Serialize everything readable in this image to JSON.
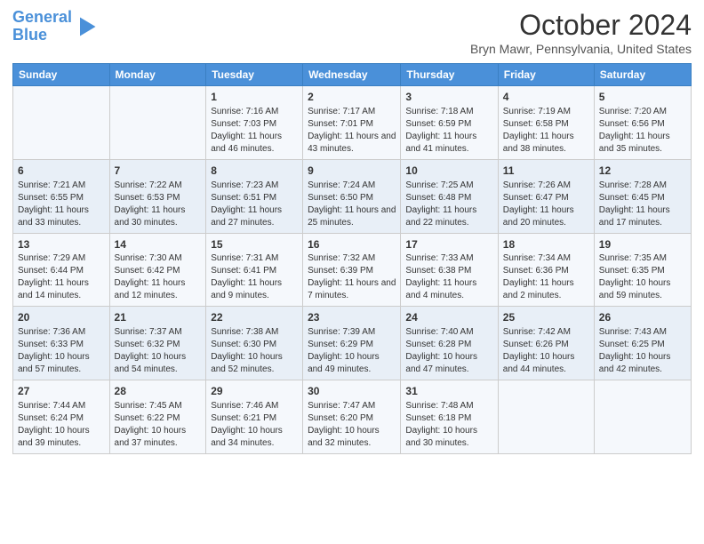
{
  "logo": {
    "text_general": "General",
    "text_blue": "Blue"
  },
  "header": {
    "month_year": "October 2024",
    "location": "Bryn Mawr, Pennsylvania, United States"
  },
  "days_of_week": [
    "Sunday",
    "Monday",
    "Tuesday",
    "Wednesday",
    "Thursday",
    "Friday",
    "Saturday"
  ],
  "weeks": [
    [
      {
        "day": "",
        "sunrise": "",
        "sunset": "",
        "daylight": ""
      },
      {
        "day": "",
        "sunrise": "",
        "sunset": "",
        "daylight": ""
      },
      {
        "day": "1",
        "sunrise": "Sunrise: 7:16 AM",
        "sunset": "Sunset: 7:03 PM",
        "daylight": "Daylight: 11 hours and 46 minutes."
      },
      {
        "day": "2",
        "sunrise": "Sunrise: 7:17 AM",
        "sunset": "Sunset: 7:01 PM",
        "daylight": "Daylight: 11 hours and 43 minutes."
      },
      {
        "day": "3",
        "sunrise": "Sunrise: 7:18 AM",
        "sunset": "Sunset: 6:59 PM",
        "daylight": "Daylight: 11 hours and 41 minutes."
      },
      {
        "day": "4",
        "sunrise": "Sunrise: 7:19 AM",
        "sunset": "Sunset: 6:58 PM",
        "daylight": "Daylight: 11 hours and 38 minutes."
      },
      {
        "day": "5",
        "sunrise": "Sunrise: 7:20 AM",
        "sunset": "Sunset: 6:56 PM",
        "daylight": "Daylight: 11 hours and 35 minutes."
      }
    ],
    [
      {
        "day": "6",
        "sunrise": "Sunrise: 7:21 AM",
        "sunset": "Sunset: 6:55 PM",
        "daylight": "Daylight: 11 hours and 33 minutes."
      },
      {
        "day": "7",
        "sunrise": "Sunrise: 7:22 AM",
        "sunset": "Sunset: 6:53 PM",
        "daylight": "Daylight: 11 hours and 30 minutes."
      },
      {
        "day": "8",
        "sunrise": "Sunrise: 7:23 AM",
        "sunset": "Sunset: 6:51 PM",
        "daylight": "Daylight: 11 hours and 27 minutes."
      },
      {
        "day": "9",
        "sunrise": "Sunrise: 7:24 AM",
        "sunset": "Sunset: 6:50 PM",
        "daylight": "Daylight: 11 hours and 25 minutes."
      },
      {
        "day": "10",
        "sunrise": "Sunrise: 7:25 AM",
        "sunset": "Sunset: 6:48 PM",
        "daylight": "Daylight: 11 hours and 22 minutes."
      },
      {
        "day": "11",
        "sunrise": "Sunrise: 7:26 AM",
        "sunset": "Sunset: 6:47 PM",
        "daylight": "Daylight: 11 hours and 20 minutes."
      },
      {
        "day": "12",
        "sunrise": "Sunrise: 7:28 AM",
        "sunset": "Sunset: 6:45 PM",
        "daylight": "Daylight: 11 hours and 17 minutes."
      }
    ],
    [
      {
        "day": "13",
        "sunrise": "Sunrise: 7:29 AM",
        "sunset": "Sunset: 6:44 PM",
        "daylight": "Daylight: 11 hours and 14 minutes."
      },
      {
        "day": "14",
        "sunrise": "Sunrise: 7:30 AM",
        "sunset": "Sunset: 6:42 PM",
        "daylight": "Daylight: 11 hours and 12 minutes."
      },
      {
        "day": "15",
        "sunrise": "Sunrise: 7:31 AM",
        "sunset": "Sunset: 6:41 PM",
        "daylight": "Daylight: 11 hours and 9 minutes."
      },
      {
        "day": "16",
        "sunrise": "Sunrise: 7:32 AM",
        "sunset": "Sunset: 6:39 PM",
        "daylight": "Daylight: 11 hours and 7 minutes."
      },
      {
        "day": "17",
        "sunrise": "Sunrise: 7:33 AM",
        "sunset": "Sunset: 6:38 PM",
        "daylight": "Daylight: 11 hours and 4 minutes."
      },
      {
        "day": "18",
        "sunrise": "Sunrise: 7:34 AM",
        "sunset": "Sunset: 6:36 PM",
        "daylight": "Daylight: 11 hours and 2 minutes."
      },
      {
        "day": "19",
        "sunrise": "Sunrise: 7:35 AM",
        "sunset": "Sunset: 6:35 PM",
        "daylight": "Daylight: 10 hours and 59 minutes."
      }
    ],
    [
      {
        "day": "20",
        "sunrise": "Sunrise: 7:36 AM",
        "sunset": "Sunset: 6:33 PM",
        "daylight": "Daylight: 10 hours and 57 minutes."
      },
      {
        "day": "21",
        "sunrise": "Sunrise: 7:37 AM",
        "sunset": "Sunset: 6:32 PM",
        "daylight": "Daylight: 10 hours and 54 minutes."
      },
      {
        "day": "22",
        "sunrise": "Sunrise: 7:38 AM",
        "sunset": "Sunset: 6:30 PM",
        "daylight": "Daylight: 10 hours and 52 minutes."
      },
      {
        "day": "23",
        "sunrise": "Sunrise: 7:39 AM",
        "sunset": "Sunset: 6:29 PM",
        "daylight": "Daylight: 10 hours and 49 minutes."
      },
      {
        "day": "24",
        "sunrise": "Sunrise: 7:40 AM",
        "sunset": "Sunset: 6:28 PM",
        "daylight": "Daylight: 10 hours and 47 minutes."
      },
      {
        "day": "25",
        "sunrise": "Sunrise: 7:42 AM",
        "sunset": "Sunset: 6:26 PM",
        "daylight": "Daylight: 10 hours and 44 minutes."
      },
      {
        "day": "26",
        "sunrise": "Sunrise: 7:43 AM",
        "sunset": "Sunset: 6:25 PM",
        "daylight": "Daylight: 10 hours and 42 minutes."
      }
    ],
    [
      {
        "day": "27",
        "sunrise": "Sunrise: 7:44 AM",
        "sunset": "Sunset: 6:24 PM",
        "daylight": "Daylight: 10 hours and 39 minutes."
      },
      {
        "day": "28",
        "sunrise": "Sunrise: 7:45 AM",
        "sunset": "Sunset: 6:22 PM",
        "daylight": "Daylight: 10 hours and 37 minutes."
      },
      {
        "day": "29",
        "sunrise": "Sunrise: 7:46 AM",
        "sunset": "Sunset: 6:21 PM",
        "daylight": "Daylight: 10 hours and 34 minutes."
      },
      {
        "day": "30",
        "sunrise": "Sunrise: 7:47 AM",
        "sunset": "Sunset: 6:20 PM",
        "daylight": "Daylight: 10 hours and 32 minutes."
      },
      {
        "day": "31",
        "sunrise": "Sunrise: 7:48 AM",
        "sunset": "Sunset: 6:18 PM",
        "daylight": "Daylight: 10 hours and 30 minutes."
      },
      {
        "day": "",
        "sunrise": "",
        "sunset": "",
        "daylight": ""
      },
      {
        "day": "",
        "sunrise": "",
        "sunset": "",
        "daylight": ""
      }
    ]
  ]
}
